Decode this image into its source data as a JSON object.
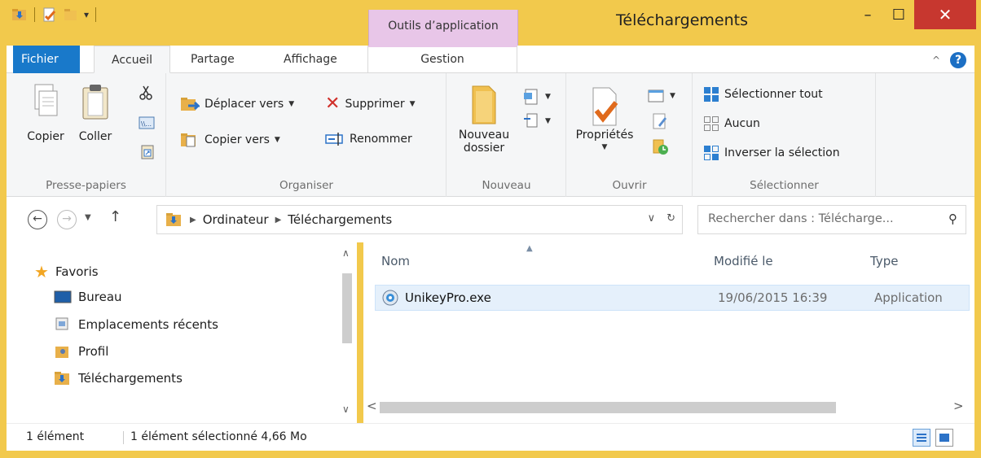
{
  "window": {
    "title": "Téléchargements",
    "context_tab_header": "Outils d’application",
    "minimize_glyph": "–",
    "maximize_glyph": "☐",
    "close_glyph": "✕"
  },
  "ribbon_tabs": {
    "file": "Fichier",
    "home": "Accueil",
    "share": "Partage",
    "view": "Affichage",
    "manage": "Gestion"
  },
  "ribbon": {
    "clipboard": {
      "label": "Presse-papiers",
      "copy": "Copier",
      "paste": "Coller"
    },
    "organize": {
      "label": "Organiser",
      "move_to": "Déplacer vers",
      "copy_to": "Copier vers",
      "delete": "Supprimer",
      "rename": "Renommer"
    },
    "new": {
      "label": "Nouveau",
      "new_folder_line1": "Nouveau",
      "new_folder_line2": "dossier"
    },
    "open": {
      "label": "Ouvrir",
      "properties": "Propriétés"
    },
    "select": {
      "label": "Sélectionner",
      "select_all": "Sélectionner tout",
      "select_none": "Aucun",
      "invert": "Inverser la sélection"
    }
  },
  "address": {
    "crumbs": [
      "Ordinateur",
      "Téléchargements"
    ],
    "search_placeholder": "Rechercher dans : Télécharge..."
  },
  "nav_pane": {
    "favorites": "Favoris",
    "items": [
      "Bureau",
      "Emplacements récents",
      "Profil",
      "Téléchargements"
    ]
  },
  "file_list": {
    "columns": {
      "name": "Nom",
      "modified": "Modifié le",
      "type": "Type"
    },
    "rows": [
      {
        "name": "UnikeyPro.exe",
        "modified": "19/06/2015 16:39",
        "type": "Application"
      }
    ]
  },
  "status": {
    "count": "1 élément",
    "selection": "1 élément sélectionné  4,66 Mo"
  },
  "colors": {
    "frame": "#f2c94c",
    "file_tab": "#1979ca",
    "context_tab": "#e8c6e8",
    "close_button": "#c7372f",
    "selection": "#e5f0fb"
  }
}
